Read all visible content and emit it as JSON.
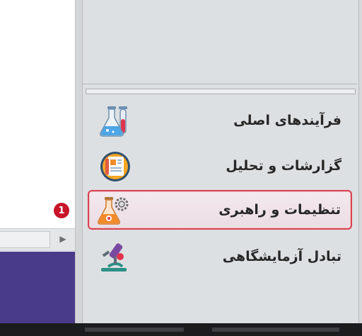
{
  "navigation": {
    "items": [
      {
        "label": "فرآیندهای اصلی",
        "icon": "lab-flasks-icon",
        "selected": false
      },
      {
        "label": "گزارشات و تحلیل",
        "icon": "report-chart-icon",
        "selected": false
      },
      {
        "label": "تنظیمات و راهبری",
        "icon": "flask-gear-icon",
        "selected": true
      },
      {
        "label": "تبادل آزمایشگاهی",
        "icon": "microscope-icon",
        "selected": false
      }
    ]
  },
  "annotation": {
    "marker_label": "1"
  },
  "colors": {
    "selection_border": "#d8434f",
    "marker": "#c8152a",
    "side_panel": "#4a3a8a"
  }
}
